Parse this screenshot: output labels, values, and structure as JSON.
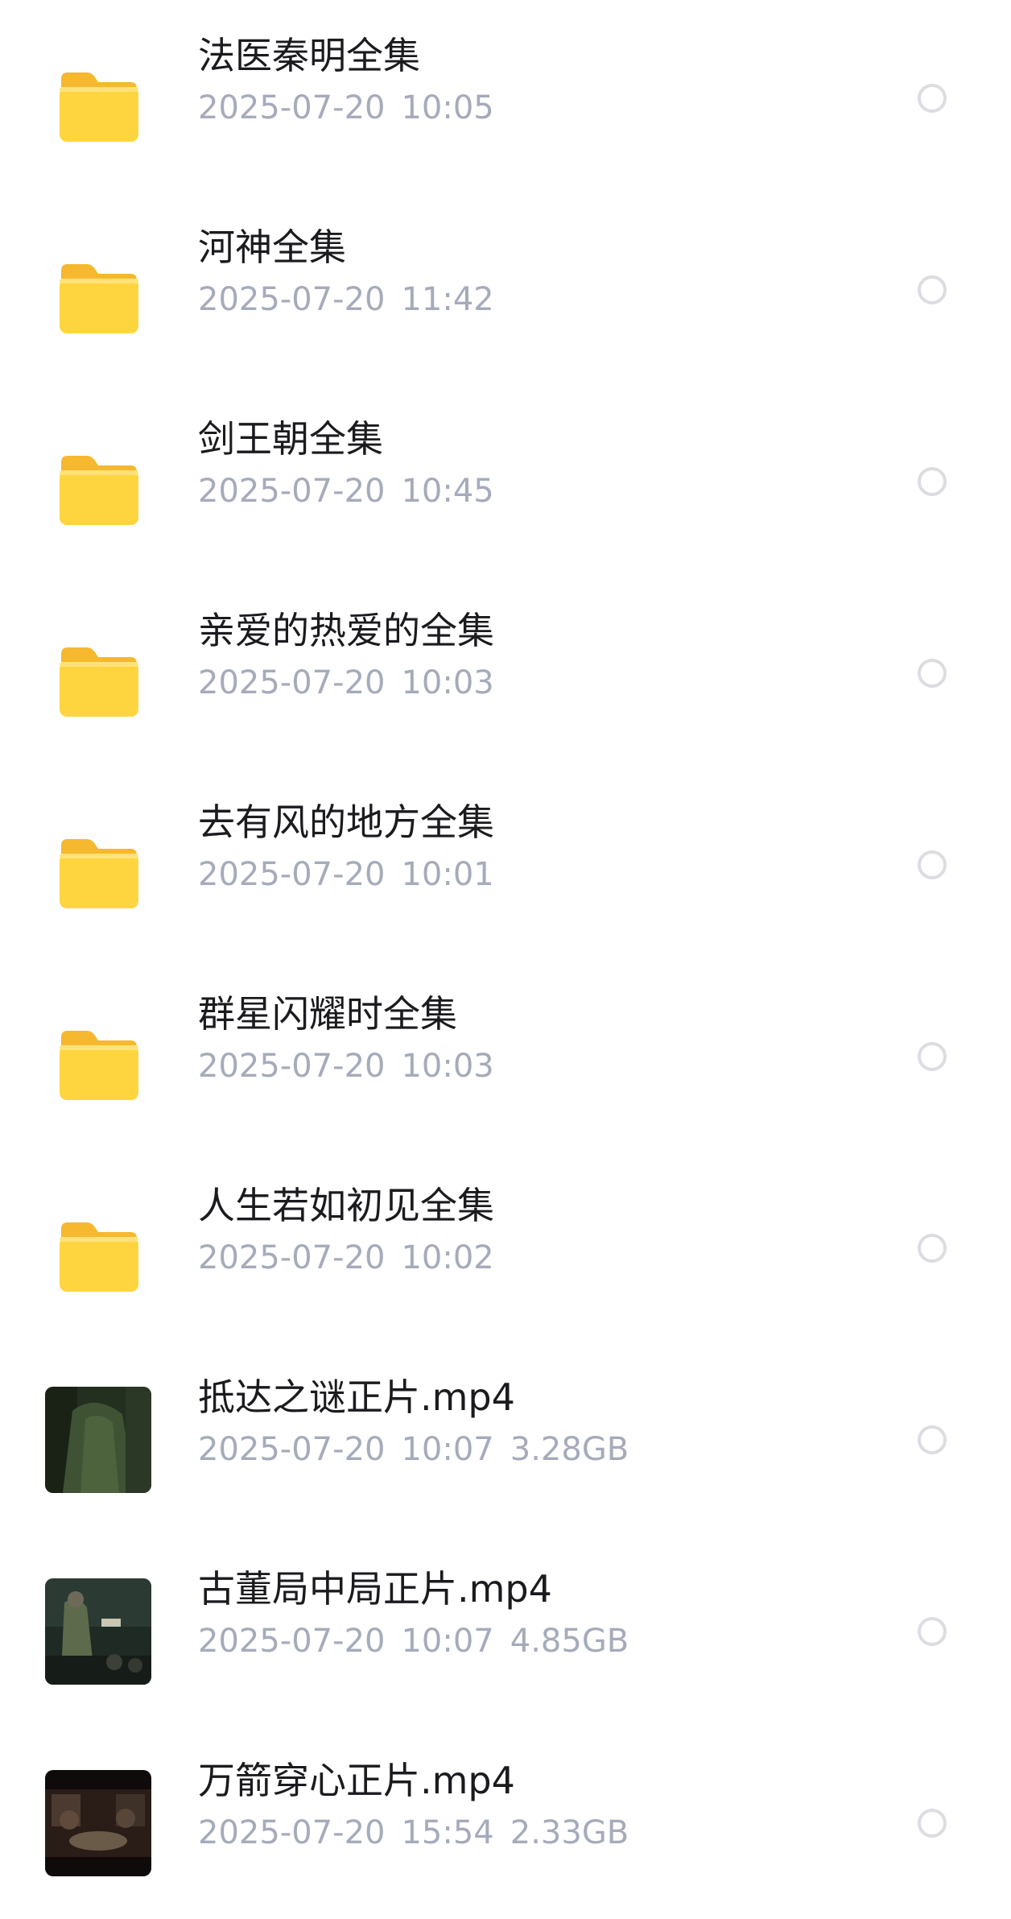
{
  "colors": {
    "folder": "#FFD53F",
    "name_text": "#1b1b1f",
    "meta_text": "#a6abbb",
    "radio_border": "#dcdde2"
  },
  "files": [
    {
      "type": "folder",
      "icon": "folder-icon",
      "name": "法医秦明全集",
      "date": "2025-07-20",
      "time": "10:05",
      "size": ""
    },
    {
      "type": "folder",
      "icon": "folder-icon",
      "name": "河神全集",
      "date": "2025-07-20",
      "time": "11:42",
      "size": ""
    },
    {
      "type": "folder",
      "icon": "folder-icon",
      "name": "剑王朝全集",
      "date": "2025-07-20",
      "time": "10:45",
      "size": ""
    },
    {
      "type": "folder",
      "icon": "folder-icon",
      "name": "亲爱的热爱的全集",
      "date": "2025-07-20",
      "time": "10:03",
      "size": ""
    },
    {
      "type": "folder",
      "icon": "folder-icon",
      "name": "去有风的地方全集",
      "date": "2025-07-20",
      "time": "10:01",
      "size": ""
    },
    {
      "type": "folder",
      "icon": "folder-icon",
      "name": "群星闪耀时全集",
      "date": "2025-07-20",
      "time": "10:03",
      "size": ""
    },
    {
      "type": "folder",
      "icon": "folder-icon",
      "name": "人生若如初见全集",
      "date": "2025-07-20",
      "time": "10:02",
      "size": ""
    },
    {
      "type": "video",
      "icon": "video-thumbnail",
      "name": "抵达之谜正片.mp4",
      "date": "2025-07-20",
      "time": "10:07",
      "size": "3.28GB"
    },
    {
      "type": "video",
      "icon": "video-thumbnail",
      "name": "古董局中局正片.mp4",
      "date": "2025-07-20",
      "time": "10:07",
      "size": "4.85GB"
    },
    {
      "type": "video",
      "icon": "video-thumbnail",
      "name": "万箭穿心正片.mp4",
      "date": "2025-07-20",
      "time": "15:54",
      "size": "2.33GB"
    }
  ]
}
